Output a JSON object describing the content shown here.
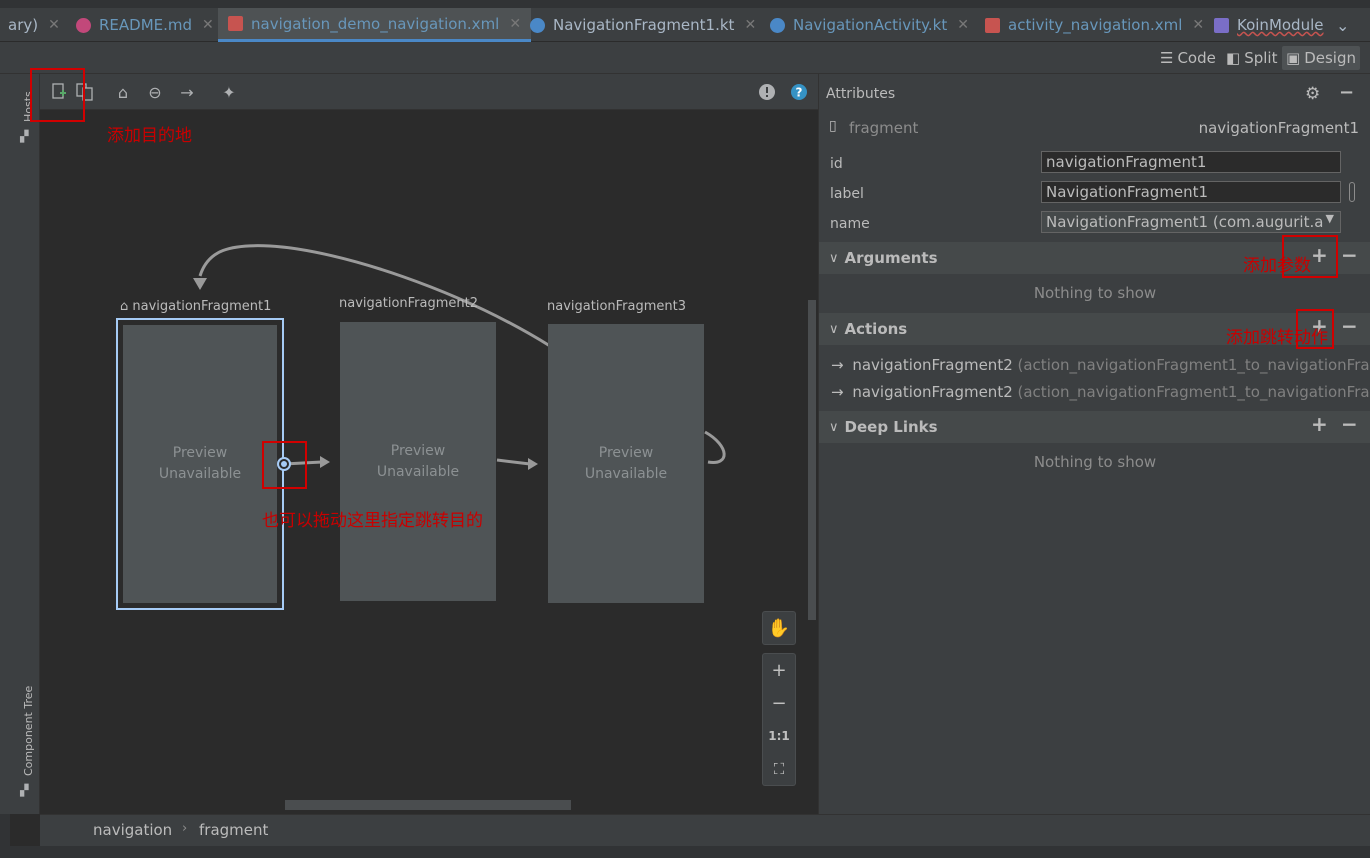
{
  "tabs": [
    {
      "label": "ary)",
      "close": "✕"
    },
    {
      "label": "README.md",
      "close": "✕"
    },
    {
      "label": "navigation_demo_navigation.xml",
      "close": "✕"
    },
    {
      "label": "NavigationFragment1.kt",
      "close": "✕"
    },
    {
      "label": "NavigationActivity.kt",
      "close": "✕"
    },
    {
      "label": "activity_navigation.xml",
      "close": "✕"
    },
    {
      "label": "KoinModule"
    }
  ],
  "modes": {
    "code": "Code",
    "split": "Split",
    "design": "Design"
  },
  "left_panel": {
    "hosts": "Hosts",
    "component_tree": "Component Tree"
  },
  "canvas": {
    "fragments": [
      {
        "label": "navigationFragment1",
        "preview": "Preview\nUnavailable"
      },
      {
        "label": "navigationFragment2",
        "preview": "Preview\nUnavailable"
      },
      {
        "label": "navigationFragment3",
        "preview": "Preview\nUnavailable"
      }
    ],
    "zoom": {
      "one_to_one": "1:1"
    }
  },
  "attributes": {
    "title": "Attributes",
    "type": "fragment",
    "selected": "navigationFragment1",
    "fields": [
      {
        "name": "id",
        "value": "navigationFragment1"
      },
      {
        "name": "label",
        "value": "NavigationFragment1"
      },
      {
        "name": "name",
        "value": "NavigationFragment1 (com.augurit.a"
      }
    ],
    "sections": {
      "arguments": {
        "title": "Arguments",
        "empty": "Nothing to show"
      },
      "actions": {
        "title": "Actions",
        "items": [
          {
            "dest": "navigationFragment2",
            "id": " (action_navigationFragment1_to_navigationFrag"
          },
          {
            "dest": "navigationFragment2",
            "id": " (action_navigationFragment1_to_navigationFrag"
          }
        ]
      },
      "deeplinks": {
        "title": "Deep Links",
        "empty": "Nothing to show"
      }
    }
  },
  "breadcrumb": [
    "navigation",
    "fragment"
  ],
  "annotations": {
    "add_destination": "添加目的地",
    "drag_hint": "也可以拖动这里指定跳转目的",
    "add_argument": "添加参数",
    "add_action": "添加跳转动作"
  },
  "colors": {
    "accent": "#4a88c7",
    "selection": "#a6cbf5",
    "annotation": "#d10000"
  }
}
